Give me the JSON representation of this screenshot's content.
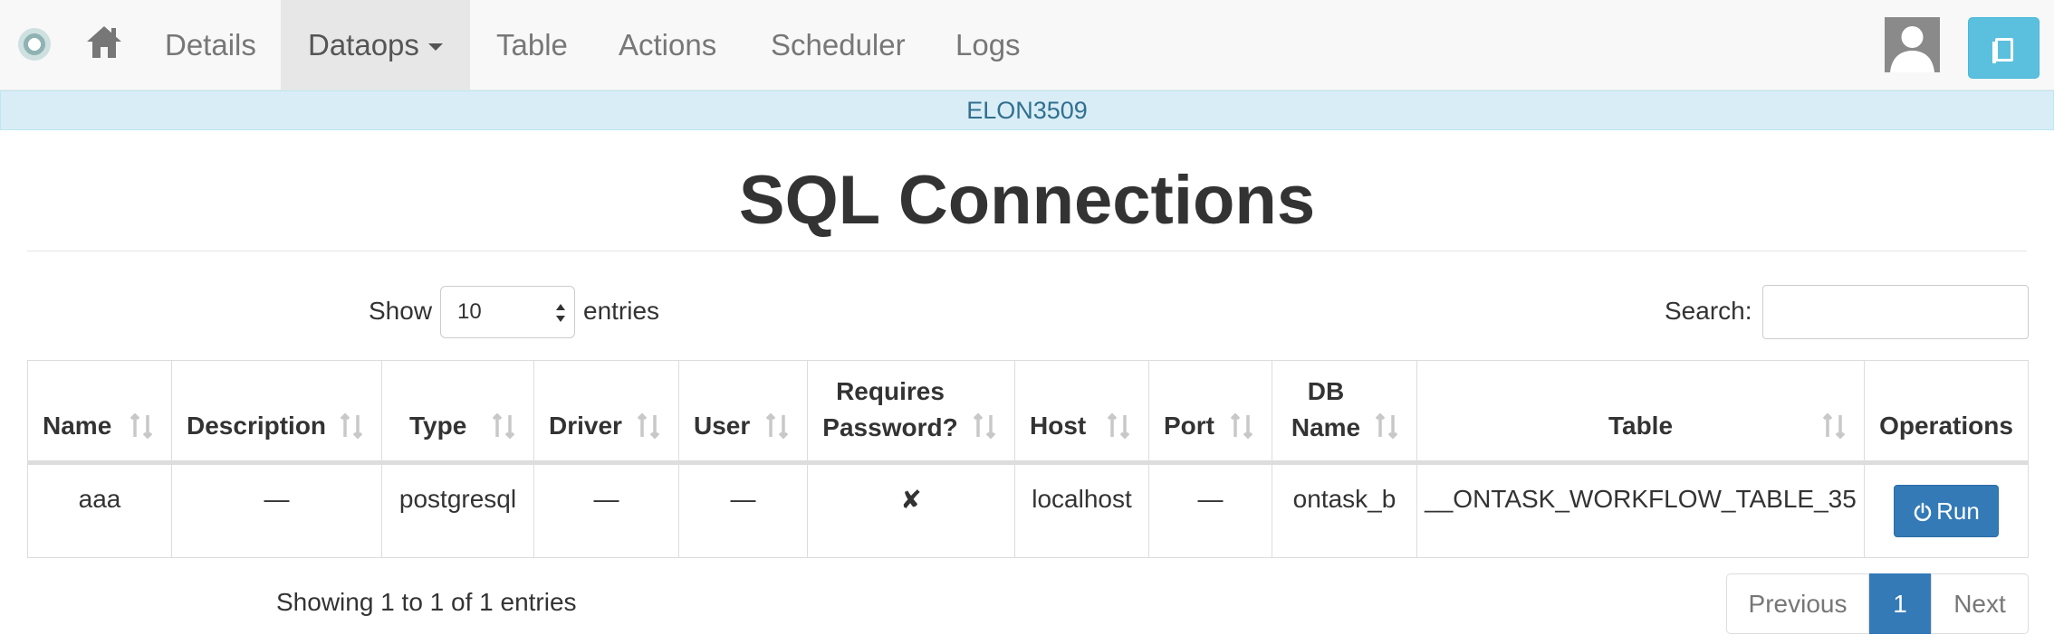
{
  "nav": {
    "items": [
      {
        "label": "Details"
      },
      {
        "label": "Dataops"
      },
      {
        "label": "Table"
      },
      {
        "label": "Actions"
      },
      {
        "label": "Scheduler"
      },
      {
        "label": "Logs"
      }
    ],
    "active": "Dataops"
  },
  "workflow_banner": "ELON3509",
  "page_title": "SQL Connections",
  "controls": {
    "show_label": "Show",
    "length_value": "10",
    "entries_label": "entries",
    "search_label": "Search:",
    "search_value": ""
  },
  "table": {
    "columns": [
      "Name",
      "Description",
      "Type",
      "Driver",
      "User",
      "Requires Password?",
      "Host",
      "Port",
      "DB Name",
      "Table",
      "Operations"
    ],
    "rows": [
      {
        "name": "aaa",
        "description": "—",
        "type": "postgresql",
        "driver": "—",
        "user": "—",
        "requires_password": "✘",
        "host": "localhost",
        "port": "—",
        "db_name": "ontask_b",
        "table": "__ONTASK_WORKFLOW_TABLE_35",
        "operation": "Run"
      }
    ]
  },
  "footer": {
    "info": "Showing 1 to 1 of 1 entries",
    "pagination": {
      "previous": "Previous",
      "current": "1",
      "next": "Next"
    }
  },
  "colors": {
    "primary": "#337ab7",
    "info_banner_bg": "#d9edf7",
    "info_banner_text": "#31708f",
    "book_button": "#5bc0de",
    "nav_bg": "#f8f8f8"
  },
  "icons": {
    "logo": "ontask-logo-icon",
    "home": "home-icon",
    "avatar": "user-avatar-icon",
    "book": "book-icon",
    "sort": "sort-arrows-icon",
    "run": "power-icon",
    "select": "select-arrows-icon"
  }
}
